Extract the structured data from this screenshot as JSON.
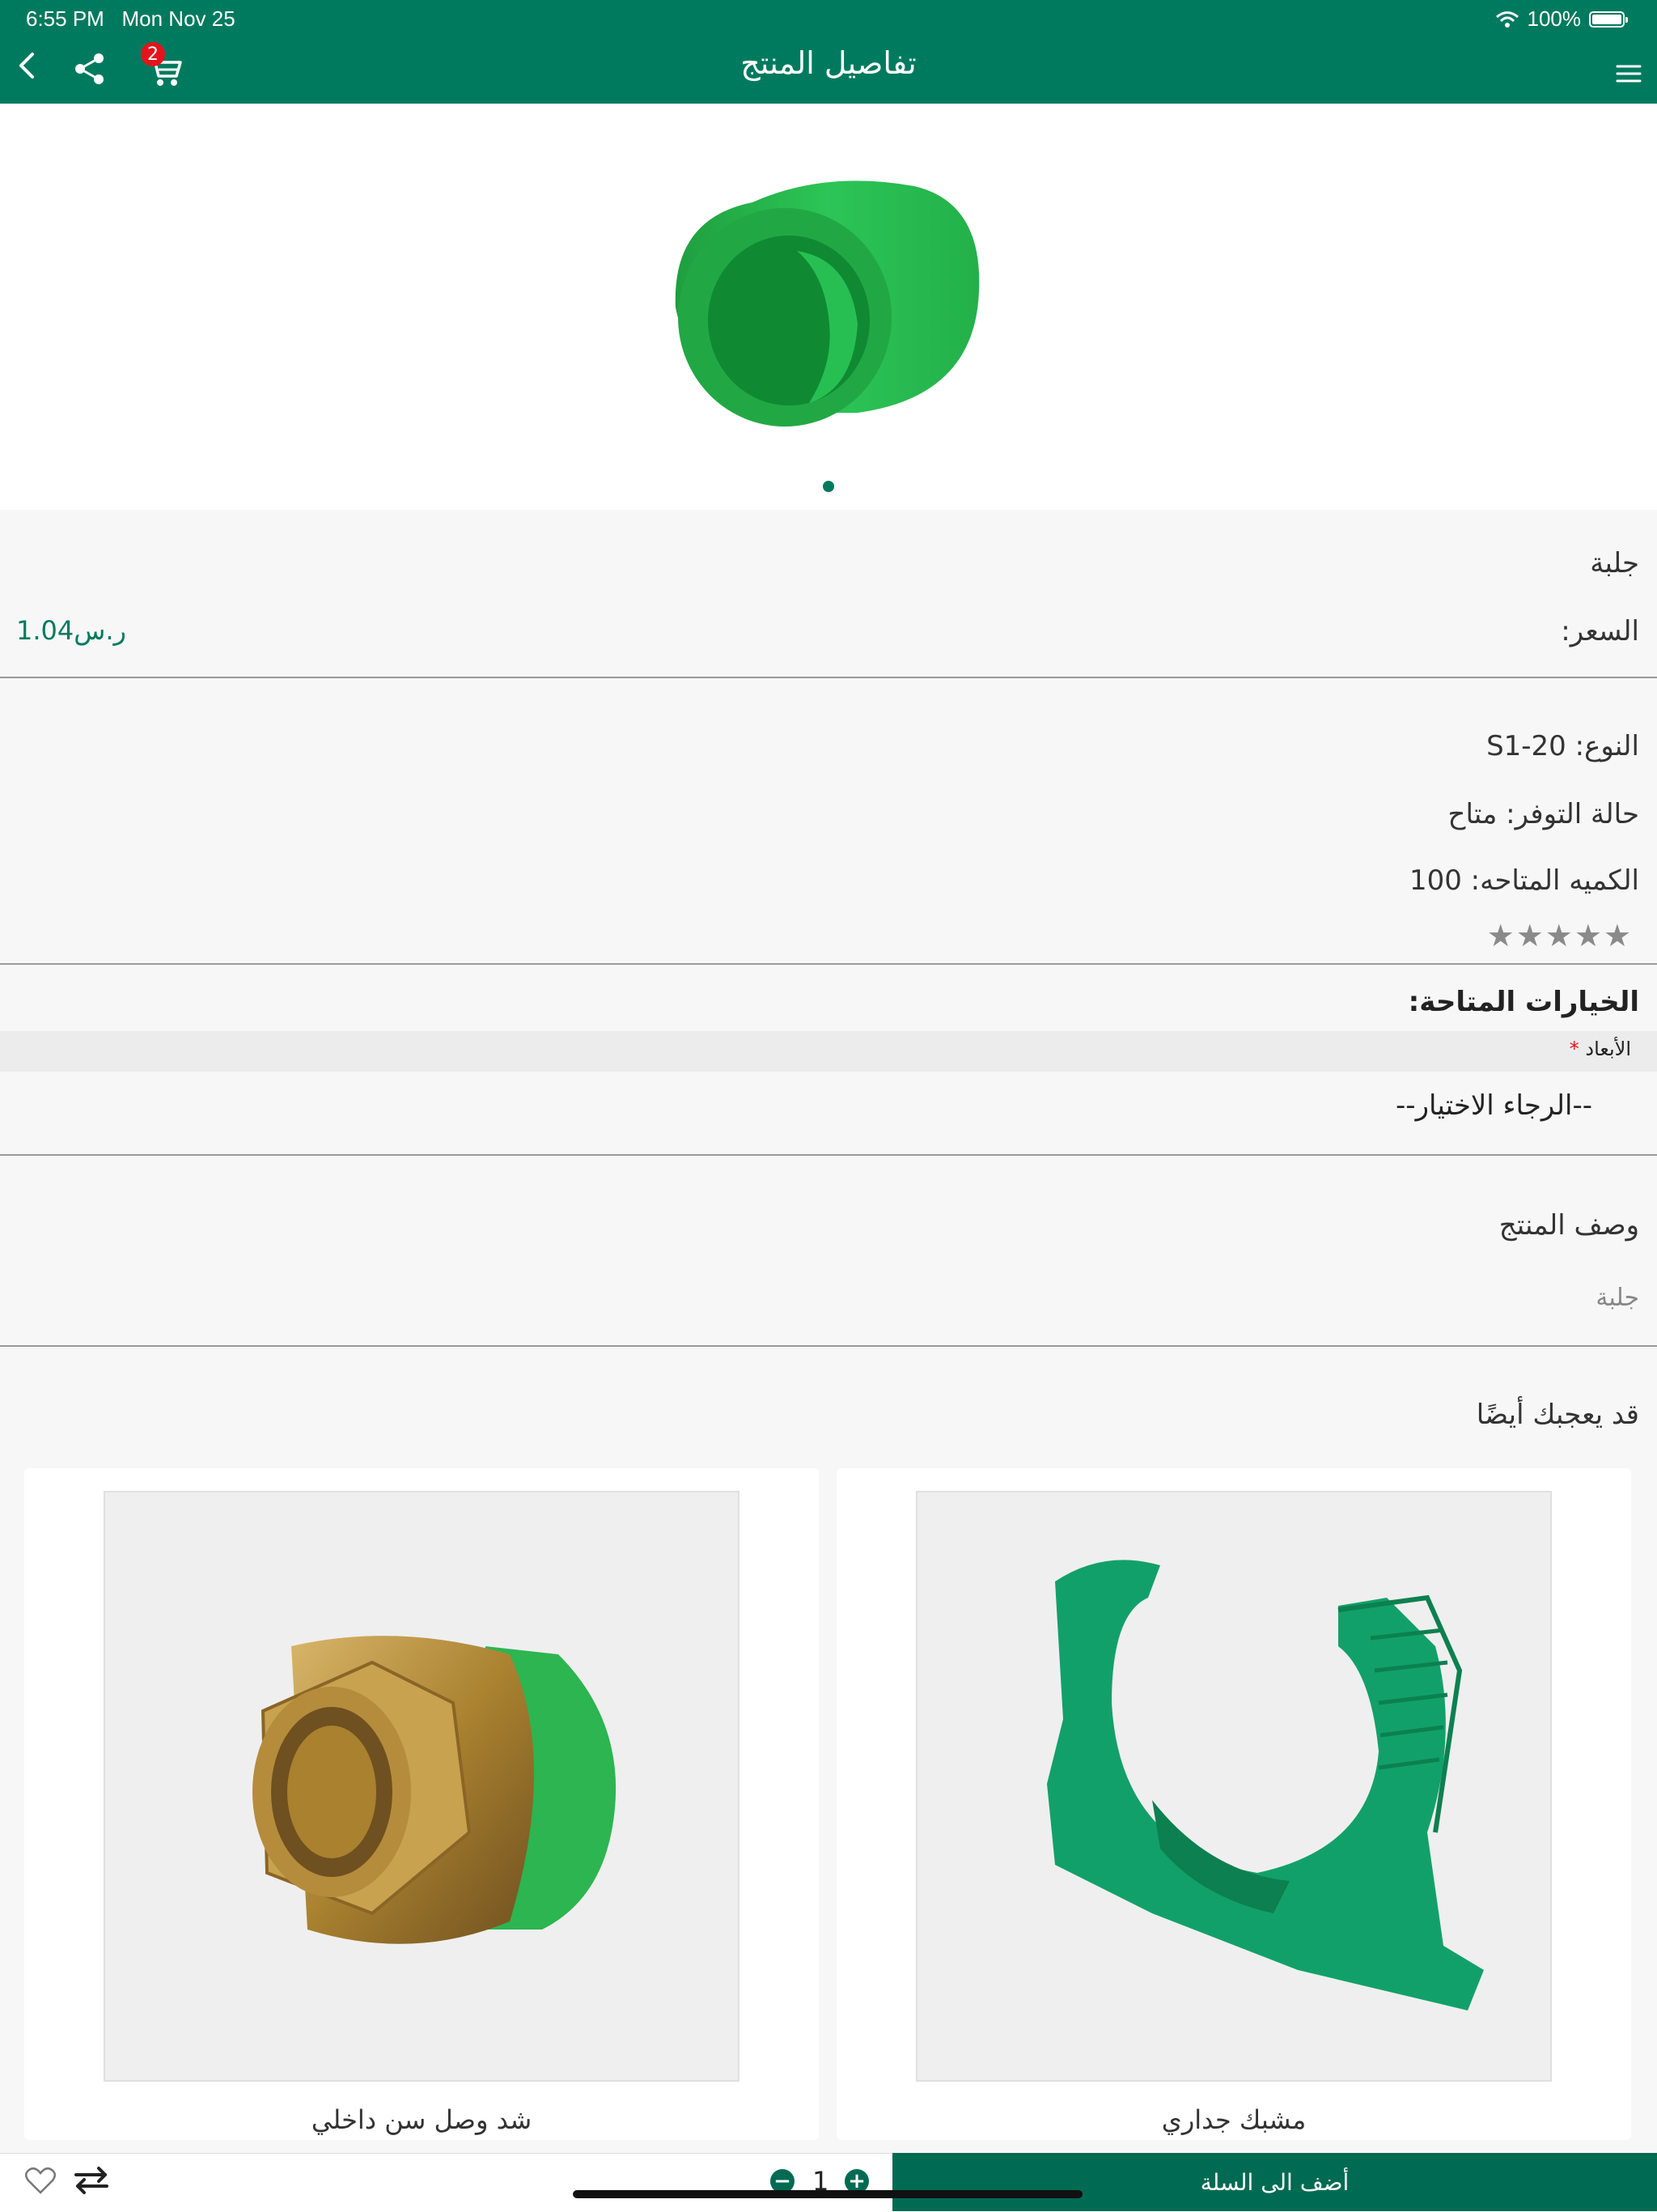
{
  "status_bar": {
    "time": "6:55 PM",
    "date": "Mon Nov 25",
    "battery": "100%"
  },
  "header": {
    "title": "تفاصيل المنتج",
    "cart_count": "2",
    "color": "#007a5e"
  },
  "product": {
    "name": "جلبة",
    "price_label": "السعر:",
    "price": "1.04ر.س",
    "type": "النوع: S1-20",
    "availability": "حالة التوفر: متاح",
    "quantity": "الكميه المتاحه: 100",
    "rating": "★★★★★",
    "image_color": "#23b04a"
  },
  "options": {
    "heading": "الخيارات المتاحة:",
    "dimension_label": "الأبعاد",
    "required_mark": "*",
    "select_placeholder": "--الرجاء الاختيار--"
  },
  "description": {
    "heading": "وصف المنتج",
    "text": "جلبة"
  },
  "related": {
    "heading": "قد يعجبك أيضًا",
    "items": [
      {
        "name": "مشبك جداري"
      },
      {
        "name": "شد وصل سن داخلي"
      }
    ]
  },
  "bottom_bar": {
    "add_to_cart": "أضف الى السلة",
    "quantity": "1",
    "minus": "−",
    "plus": "+"
  }
}
